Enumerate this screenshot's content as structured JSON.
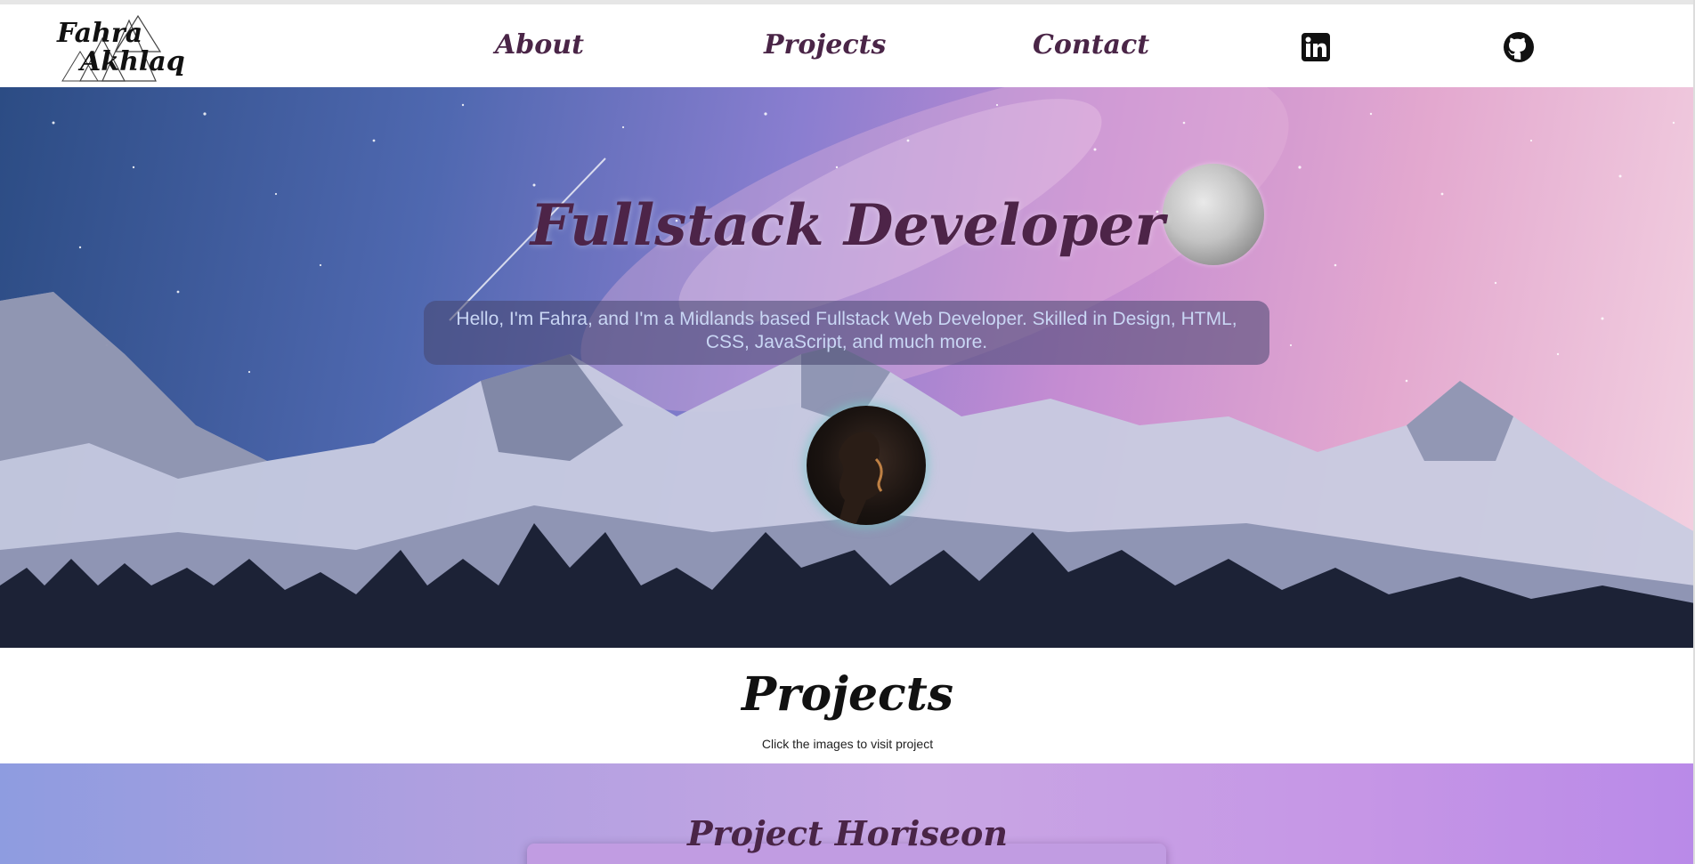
{
  "header": {
    "logo": {
      "line1": "Fahra",
      "line2": "Akhlaq"
    },
    "nav": [
      {
        "label": "About"
      },
      {
        "label": "Projects"
      },
      {
        "label": "Contact"
      }
    ],
    "social": [
      {
        "icon": "linkedin-icon"
      },
      {
        "icon": "github-icon"
      }
    ]
  },
  "hero": {
    "title": "Fullstack Developer",
    "description": "Hello, I'm Fahra, and I'm a Midlands based Fullstack Web Developer. Skilled in Design, HTML, CSS, JavaScript, and much more."
  },
  "projects": {
    "title": "Projects",
    "subtitle": "Click the images to visit project",
    "items": [
      {
        "title": "Project Horiseon"
      }
    ]
  },
  "colors": {
    "accent": "#4a2547",
    "band_start": "#8e9ce0",
    "band_end": "#b98ae8"
  }
}
